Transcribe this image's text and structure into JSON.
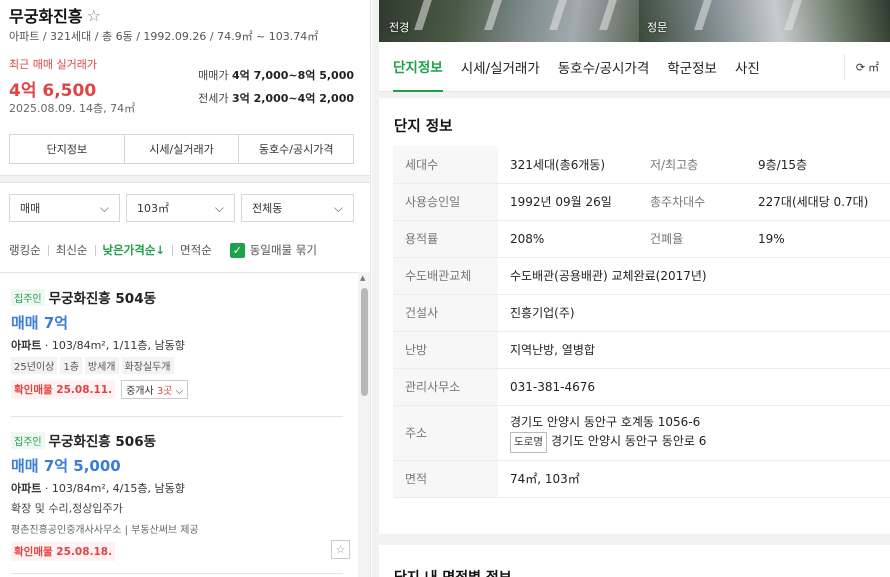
{
  "complex": {
    "name": "무궁화진흥",
    "subinfo": "아파트 / 321세대 / 총 6동 / 1992.09.26 / 74.9㎡ ~ 103.74㎡"
  },
  "recent": {
    "label": "최근 매매 실거래가",
    "price": "4억 6,500",
    "date": "2025.08.09. 14층, 74㎡"
  },
  "ranges": {
    "sale_label": "매매가",
    "sale_value": "4억 7,000~8억 5,000",
    "jeonse_label": "전세가",
    "jeonse_value": "3억 2,000~4억 2,000"
  },
  "left_tabs": [
    "단지정보",
    "시세/실거래가",
    "동호수/공시가격"
  ],
  "filters": {
    "trade_type": "매매",
    "area": "103㎡",
    "dong": "전체동"
  },
  "sort": {
    "options": [
      "랭킹순",
      "최신순",
      "낮은가격순↓",
      "면적순"
    ],
    "active_index": 2,
    "group_label": "동일매물 묶기",
    "group_checked": true
  },
  "listings": [
    {
      "tag": "집주인",
      "name": "무궁화진흥 504동",
      "price": "매매 7억",
      "spec_type": "아파트",
      "spec": " · 103/84m², 1/11층, 남동향",
      "features": [
        "25년이상",
        "1층",
        "방세개",
        "화장실두개"
      ],
      "desc": "",
      "agent": "",
      "confirm": "확인매물 25.08.11.",
      "brokers_prefix": "중개사 ",
      "brokers_count": "3곳",
      "brokers_suffix": " ⌵"
    },
    {
      "tag": "집주인",
      "name": "무궁화진흥 506동",
      "price": "매매 7억 5,000",
      "spec_type": "아파트",
      "spec": " · 103/84m², 4/15층, 남동향",
      "features": [],
      "desc": "확장 및 수리,정상입주가",
      "agent": "평촌진흥공인중개사사무소 | 부동산써브 제공",
      "confirm": "확인매물 25.08.18.",
      "brokers_prefix": "",
      "brokers_count": "",
      "brokers_suffix": ""
    }
  ],
  "photos": [
    {
      "label": "전경"
    },
    {
      "label": "정문"
    }
  ],
  "right_tabs": [
    "단지정보",
    "시세/실거래가",
    "동호수/공시가격",
    "학군정보",
    "사진"
  ],
  "unit_toggle": "㎡",
  "info": {
    "title": "단지 정보",
    "rows": [
      {
        "k": "세대수",
        "v": "321세대(총6개동)",
        "k2": "저/최고층",
        "v2": "9층/15층"
      },
      {
        "k": "사용승인일",
        "v": "1992년 09월 26일",
        "k2": "총주차대수",
        "v2": "227대(세대당 0.7대)"
      },
      {
        "k": "용적률",
        "v": "208%",
        "k2": "건폐율",
        "v2": "19%"
      },
      {
        "k": "수도배관교체",
        "v": "수도배관(공용배관) 교체완료(2017년)"
      },
      {
        "k": "건설사",
        "v": "진흥기업(주)"
      },
      {
        "k": "난방",
        "v": "지역난방, 열병합"
      },
      {
        "k": "관리사무소",
        "v": "031-381-4676"
      }
    ],
    "address": {
      "k": "주소",
      "jibun": "경기도 안양시 동안구 호계동 1056-6",
      "road_badge": "도로명",
      "road": "경기도 안양시 동안구 동안로 6"
    },
    "area_row": {
      "k": "면적",
      "v": "74㎡, 103㎡"
    }
  },
  "next_section_title": "단지 내 면적별 정보"
}
